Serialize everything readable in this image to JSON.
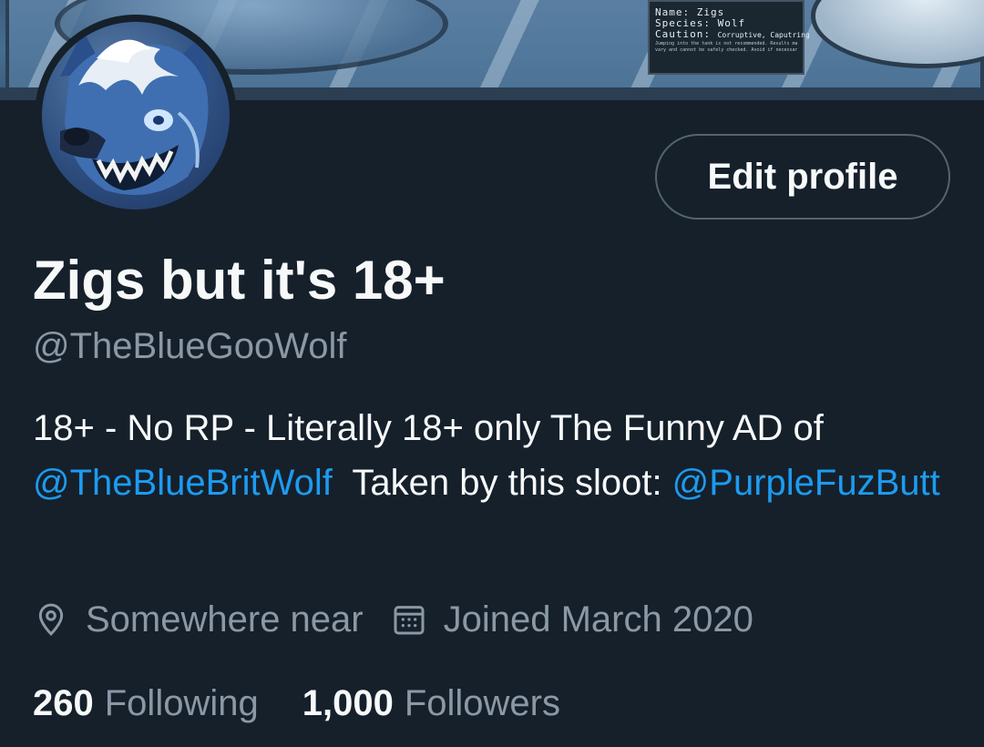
{
  "banner": {
    "sign": {
      "name_label": "Name:",
      "name_value": "Zigs",
      "species_label": "Species:",
      "species_value": "Wolf",
      "caution_label": "Caution:",
      "caution_value": "Corruptive, Caputring",
      "fine_print_1": "Jumping into the tank is not recommended. Results may",
      "fine_print_2": "vary and cannot be safely checked. Avoid if necessary."
    }
  },
  "profile": {
    "edit_button_label": "Edit profile",
    "display_name": "Zigs but it's 18+",
    "handle": "@TheBlueGooWolf",
    "bio": {
      "text_1": "18+ - No RP - Literally 18+ only The Funny AD of ",
      "mention_1": "@TheBlueBritWolf",
      "text_2": "  Taken by this sloot: ",
      "mention_2": "@PurpleFuzButt"
    },
    "location": "Somewhere near",
    "joined": "Joined March 2020",
    "following_count": "260",
    "following_label": "Following",
    "followers_count": "1,000",
    "followers_label": "Followers"
  },
  "colors": {
    "background": "#15202b",
    "text_primary": "#f7f9f9",
    "text_secondary": "#8b98a5",
    "link": "#1d9bf0",
    "border": "#536471"
  }
}
